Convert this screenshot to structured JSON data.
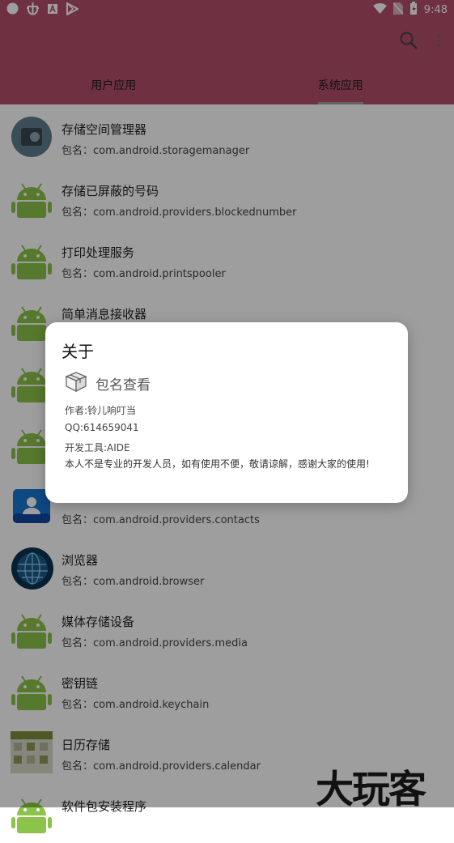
{
  "status_bar": {
    "time": "9:48"
  },
  "tabs": [
    {
      "label": "用户应用",
      "selected": false
    },
    {
      "label": "系统应用",
      "selected": true
    }
  ],
  "apps": [
    {
      "name": "存储空间管理器",
      "package": "包名：com.android.storagemanager",
      "icon": "storage-manager-icon"
    },
    {
      "name": "存储已屏蔽的号码",
      "package": "包名：com.android.providers.blockednumber",
      "icon": "android-icon"
    },
    {
      "name": "打印处理服务",
      "package": "包名：com.android.printspooler",
      "icon": "android-icon"
    },
    {
      "name": "简单消息接收器",
      "package": "",
      "icon": "android-icon"
    },
    {
      "name": "",
      "package": "",
      "icon": "android-icon"
    },
    {
      "name": "",
      "package": "",
      "icon": "android-icon"
    },
    {
      "name": "",
      "package": "包名：com.android.providers.contacts",
      "icon": "contacts-icon"
    },
    {
      "name": "浏览器",
      "package": "包名：com.android.browser",
      "icon": "browser-globe-icon"
    },
    {
      "name": "媒体存储设备",
      "package": "包名：com.android.providers.media",
      "icon": "android-icon"
    },
    {
      "name": "密钥链",
      "package": "包名：com.android.keychain",
      "icon": "android-icon"
    },
    {
      "name": "日历存储",
      "package": "包名：com.android.providers.calendar",
      "icon": "calendar-icon"
    },
    {
      "name": "软件包安装程序",
      "package": "",
      "icon": "android-icon"
    }
  ],
  "dialog": {
    "title": "关于",
    "app_name": "包名查看",
    "author": "作者:铃儿响叮当",
    "qq": "QQ:614659041",
    "tool": "开发工具:AIDE",
    "description": "本人不是专业的开发人员，如有使用不便，敬请谅解，感谢大家的使用!"
  },
  "watermark": "大玩客",
  "colors": {
    "app_bar": "#b34f6a",
    "android_green": "#8cc34a"
  }
}
